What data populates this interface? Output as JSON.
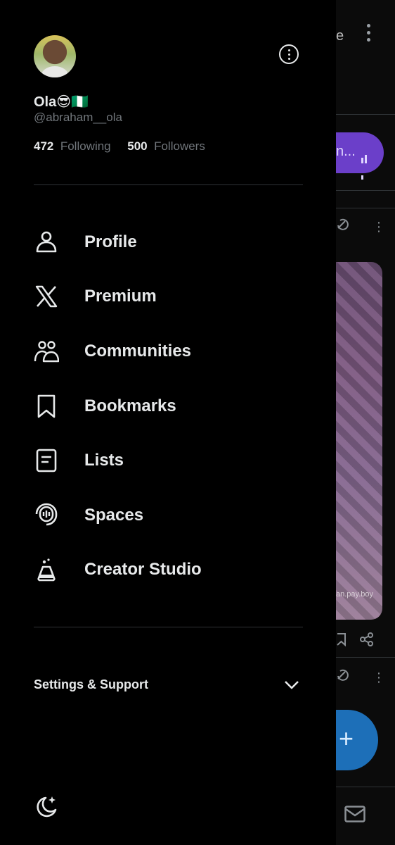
{
  "profile": {
    "name": "Ola😎🇳🇬",
    "handle": "@abraham__ola",
    "following_count": "472",
    "following_label": "Following",
    "followers_count": "500",
    "followers_label": "Followers"
  },
  "nav": {
    "items": [
      {
        "label": "Profile",
        "icon": "person-icon"
      },
      {
        "label": "Premium",
        "icon": "x-logo-icon"
      },
      {
        "label": "Communities",
        "icon": "communities-icon"
      },
      {
        "label": "Bookmarks",
        "icon": "bookmark-icon"
      },
      {
        "label": "Lists",
        "icon": "list-icon"
      },
      {
        "label": "Spaces",
        "icon": "spaces-icon"
      },
      {
        "label": "Creator Studio",
        "icon": "flask-icon"
      }
    ]
  },
  "settings": {
    "label": "Settings & Support"
  },
  "background": {
    "top_fragment": "e",
    "pill_fragment": "n...",
    "photo_caption": "an.pay.boy"
  },
  "colors": {
    "background": "#000000",
    "text_primary": "#e7e9ea",
    "text_secondary": "#71767b",
    "divider": "#2f3336",
    "accent_purple": "#6b3fc9",
    "fab_blue": "#1d6fb8"
  }
}
